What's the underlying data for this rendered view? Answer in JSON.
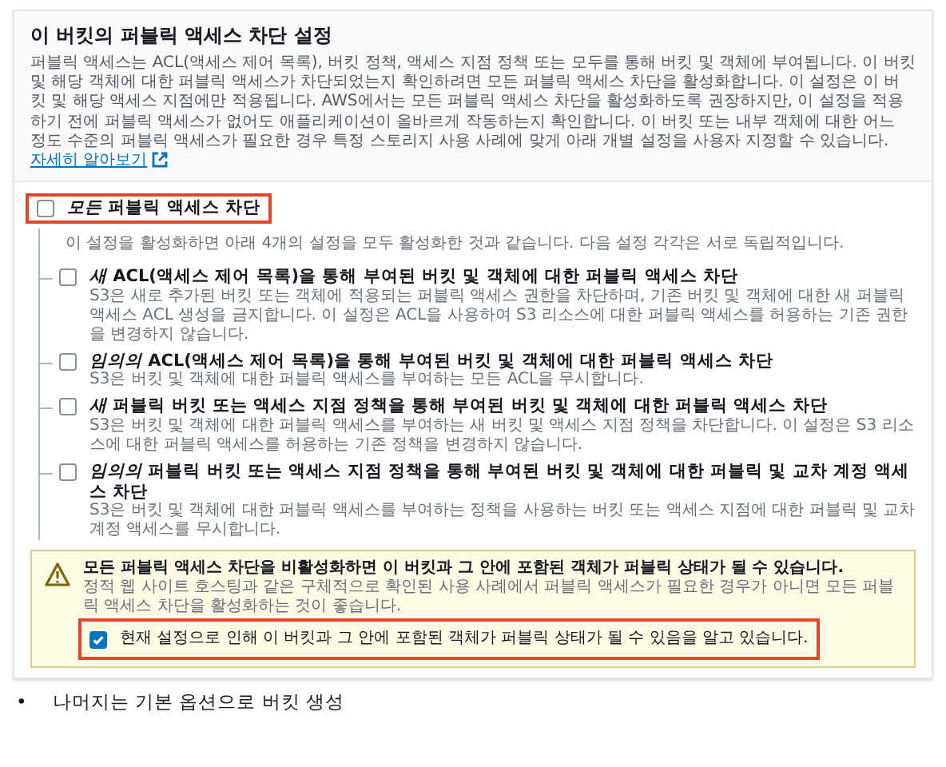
{
  "panel": {
    "title": "이 버킷의 퍼블릭 액세스 차단 설정",
    "description": "퍼블릭 액세스는 ACL(액세스 제어 목록), 버킷 정책, 액세스 지점 정책 또는 모두를 통해 버킷 및 객체에 부여됩니다. 이 버킷 및 해당 객체에 대한 퍼블릭 액세스가 차단되었는지 확인하려면 모든 퍼블릭 액세스 차단을 활성화합니다. 이 설정은 이 버킷 및 해당 액세스 지점에만 적용됩니다. AWS에서는 모든 퍼블릭 액세스 차단을 활성화하도록 권장하지만, 이 설정을 적용하기 전에 퍼블릭 액세스가 없어도 애플리케이션이 올바르게 작동하는지 확인합니다. 이 버킷 또는 내부 객체에 대한 어느 정도 수준의 퍼블릭 액세스가 필요한 경우 특정 스토리지 사용 사례에 맞게 아래 개별 설정을 사용자 지정할 수 있습니다.",
    "link": "자세히 알아보기"
  },
  "block_all": {
    "label": "*모든* 퍼블릭 액세스 차단",
    "checked": false,
    "highlighted": true,
    "description": "이 설정을 활성화하면 아래 4개의 설정을 모두 활성화한 것과 같습니다. 다음 설정 각각은 서로 독립적입니다."
  },
  "options": [
    {
      "label": "*새* ACL(액세스 제어 목록)을 통해 부여된 버킷 및 객체에 대한 퍼블릭 액세스 차단",
      "checked": false,
      "description": "S3은 새로 추가된 버킷 또는 객체에 적용되는 퍼블릭 액세스 권한을 차단하며, 기존 버킷 및 객체에 대한 새 퍼블릭 액세스 ACL 생성을 금지합니다. 이 설정은 ACL을 사용하여 S3 리소스에 대한 퍼블릭 액세스를 허용하는 기존 권한을 변경하지 않습니다."
    },
    {
      "label": "*임의의* ACL(액세스 제어 목록)을 통해 부여된 버킷 및 객체에 대한 퍼블릭 액세스 차단",
      "checked": false,
      "description": "S3은 버킷 및 객체에 대한 퍼블릭 액세스를 부여하는 모든 ACL을 무시합니다."
    },
    {
      "label": "*새* 퍼블릭 버킷 또는 액세스 지점 정책을 통해 부여된 버킷 및 객체에 대한 퍼블릭 액세스 차단",
      "checked": false,
      "description": "S3은 버킷 및 객체에 대한 퍼블릭 액세스를 부여하는 새 버킷 및 액세스 지점 정책을 차단합니다. 이 설정은 S3 리소스에 대한 퍼블릭 액세스를 허용하는 기존 정책을 변경하지 않습니다."
    },
    {
      "label": "*임의의* 퍼블릭 버킷 또는 액세스 지점 정책을 통해 부여된 버킷 및 객체에 대한 퍼블릭 및 교차 계정 액세스 차단",
      "checked": false,
      "description": "S3은 버킷 및 객체에 대한 퍼블릭 액세스를 부여하는 정책을 사용하는 버킷 또는 액세스 지점에 대한 퍼블릭 및 교차 계정 액세스를 무시합니다."
    }
  ],
  "warning": {
    "title": "모든 퍼블릭 액세스 차단을 비활성화하면 이 버킷과 그 안에 포함된 객체가 퍼블릭 상태가 될 수 있습니다.",
    "body": "정적 웹 사이트 호스팅과 같은 구체적으로 확인된 사용 사례에서 퍼블릭 액세스가 필요한 경우가 아니면 모든 퍼블릭 액세스 차단을 활성화하는 것이 좋습니다.",
    "acknowledge": {
      "label": "현재 설정으로 인해 이 버킷과 그 안에 포함된 객체가 퍼블릭 상태가 될 수 있음을 알고 있습니다.",
      "checked": true,
      "highlighted": true
    }
  },
  "bullets": [
    {
      "marker": "•",
      "text": "나머지는 기본 옵션으로 버킷 생성"
    }
  ]
}
